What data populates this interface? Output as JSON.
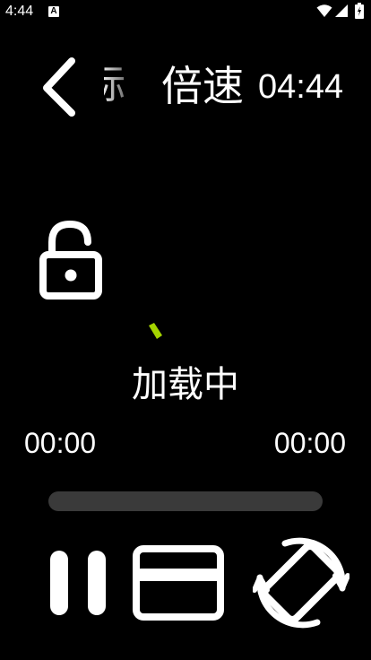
{
  "status_bar": {
    "time": "4:44",
    "notification_letter": "A",
    "icons": [
      "a-notification-icon",
      "wifi-icon",
      "signal-icon",
      "battery-icon"
    ]
  },
  "top_bar": {
    "title": "标",
    "speed_label": "倍速",
    "clock": "04:44",
    "icons": [
      "back-chevron-icon"
    ]
  },
  "player": {
    "loading_text": "加载中",
    "time_current": "00:00",
    "time_total": "00:00",
    "progress_fraction": 0,
    "spinner_color": "#a4d300",
    "icons": [
      "unlock-icon",
      "pause-icon",
      "fullscreen-icon",
      "rotate-screen-icon"
    ]
  }
}
